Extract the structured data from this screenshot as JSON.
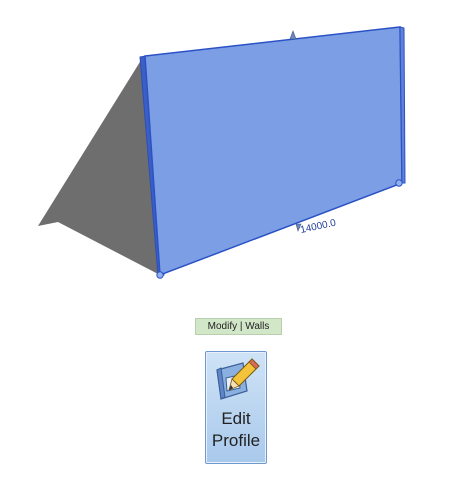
{
  "viewport": {
    "dimension_value": "14000.0",
    "colors": {
      "wall_face": "#7c9ee5",
      "wall_edge": "#2a52c6",
      "shadow": "#6e6e6e"
    }
  },
  "ribbon": {
    "context_tab_label": "Modify | Walls",
    "edit_profile": {
      "line1": "Edit",
      "line2": "Profile",
      "icon": "edit-profile-pencil-icon"
    }
  }
}
